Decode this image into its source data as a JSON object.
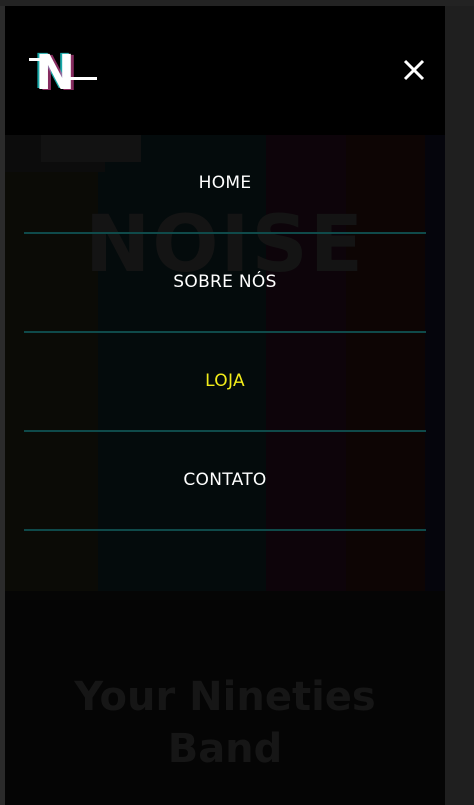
{
  "header": {
    "logo_letter": "N",
    "close_icon": "close-icon"
  },
  "menu": {
    "items": [
      {
        "label": "HOME",
        "active": false
      },
      {
        "label": "SOBRE NÓS",
        "active": false
      },
      {
        "label": "LOJA",
        "active": true
      },
      {
        "label": "CONTATO",
        "active": false
      }
    ]
  },
  "hero": {
    "word": "NOISE",
    "tagline_line1": "Your Nineties",
    "tagline_line2": "Band"
  },
  "colors": {
    "active": "#f2ec1a",
    "divider": "#0f4a4a",
    "text": "#ffffff",
    "background": "#000000"
  }
}
